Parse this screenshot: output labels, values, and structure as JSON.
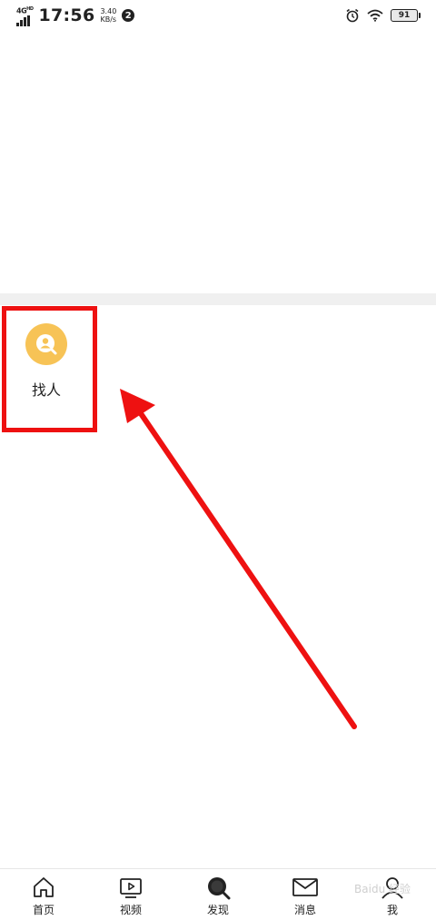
{
  "status_bar": {
    "network": "4G",
    "network_sup": "HD",
    "time": "17:56",
    "speed_value": "3.40",
    "speed_unit": "KB/s",
    "notification_count": "2",
    "battery": "91"
  },
  "discover": {
    "find_people_label": "找人",
    "find_people_icon": "person-search-icon",
    "accent_color": "#f7c356"
  },
  "bottom_nav": {
    "items": [
      {
        "label": "首页",
        "icon": "home-icon"
      },
      {
        "label": "视频",
        "icon": "video-icon"
      },
      {
        "label": "发现",
        "icon": "discover-search-icon"
      },
      {
        "label": "消息",
        "icon": "mail-icon"
      },
      {
        "label": "我",
        "icon": "profile-icon"
      }
    ],
    "active_index": 2
  },
  "watermark": "Baidu 经验",
  "annotation": {
    "color": "#ee1111"
  }
}
